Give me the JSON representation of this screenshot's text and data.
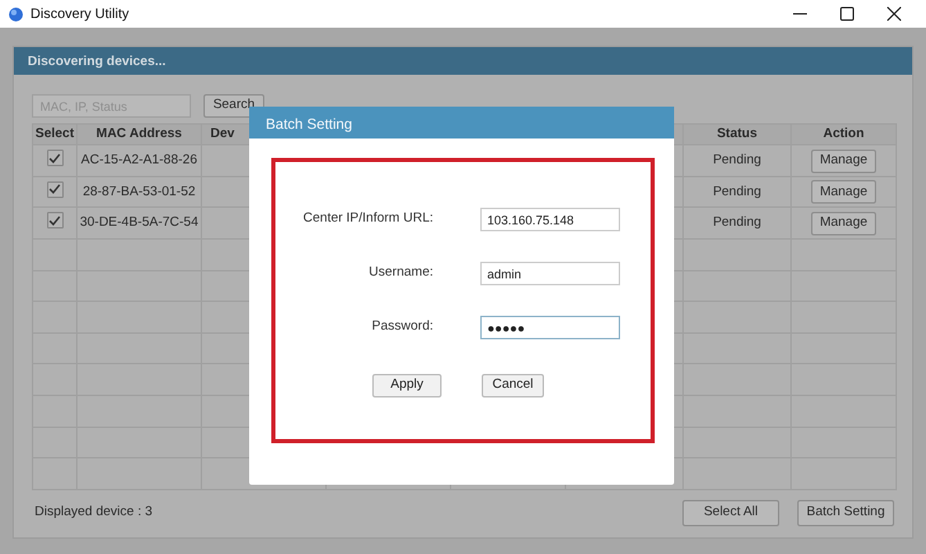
{
  "window": {
    "title": "Discovery Utility"
  },
  "panel": {
    "title": "Discovering devices...",
    "search": {
      "placeholder": "MAC, IP, Status",
      "button": "Search"
    }
  },
  "table": {
    "columns": [
      {
        "label": "Select"
      },
      {
        "label": "MAC Address"
      },
      {
        "label": "Dev"
      },
      {
        "label": "Status"
      },
      {
        "label": "Action"
      }
    ],
    "rows": [
      {
        "checked": true,
        "mac": "AC-15-A2-A1-88-26",
        "status": "Pending",
        "action": "Manage"
      },
      {
        "checked": true,
        "mac": "28-87-BA-53-01-52",
        "status": "Pending",
        "action": "Manage"
      },
      {
        "checked": true,
        "mac": "30-DE-4B-5A-7C-54",
        "status": "Pending",
        "action": "Manage"
      }
    ]
  },
  "footer": {
    "count": "Displayed device : 3",
    "buttons": [
      "Select All",
      "Batch Setting"
    ]
  },
  "dialog": {
    "title": "Batch Setting",
    "fields": [
      {
        "label": "Center IP/Inform URL:",
        "value": "103.160.75.148",
        "focused": false
      },
      {
        "label": "Username:",
        "value": "admin",
        "focused": false
      },
      {
        "label": "Password:",
        "value": "●●●●●",
        "focused": true
      }
    ],
    "buttons": [
      "Apply",
      "Cancel"
    ]
  }
}
